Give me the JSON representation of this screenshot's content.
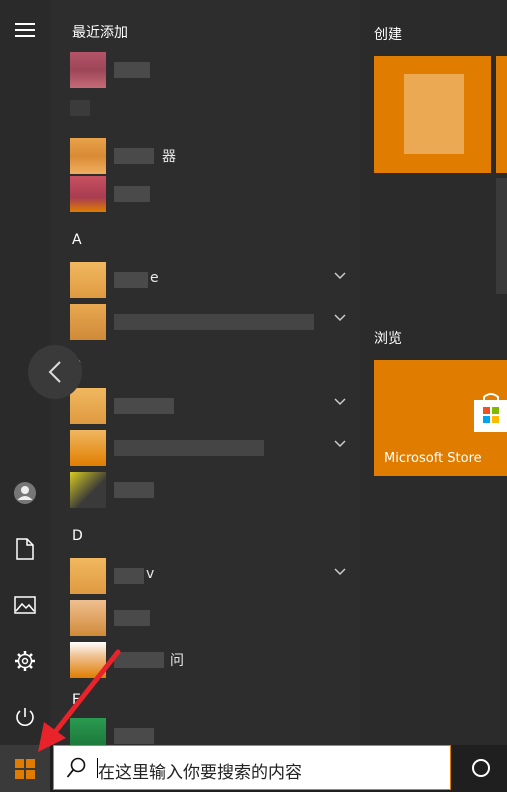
{
  "app_list": {
    "recent_header": "最近添加",
    "sections": [
      "A",
      "B",
      "D",
      "E"
    ],
    "recent_items": [
      {
        "label": "",
        "colors": [
          "#c35a6a",
          "#b05060",
          "#c07070"
        ]
      },
      {
        "label": "器",
        "colors": [
          "#e8a24a",
          "#d98a35",
          "#f0b060"
        ]
      },
      {
        "label": "",
        "colors": [
          "#c85060",
          "#a83c50",
          "#e07d00"
        ]
      }
    ],
    "a_items": [
      {
        "label": "e",
        "expandable": true
      },
      {
        "label": "",
        "expandable": true
      }
    ],
    "b_items": [
      {
        "label": "",
        "expandable": true
      },
      {
        "label": "",
        "expandable": true
      },
      {
        "label": "",
        "expandable": false
      }
    ],
    "d_items": [
      {
        "label": "v",
        "expandable": true
      },
      {
        "label": "",
        "expandable": false
      },
      {
        "label": "问",
        "expandable": false
      }
    ]
  },
  "tiles": {
    "create_group": "创建",
    "browse_group": "浏览",
    "store_label": "Microsoft Store"
  },
  "taskbar": {
    "search_placeholder": "在这里输入你要搜索的内容"
  },
  "colors": {
    "accent": "#e07d00",
    "arrow": "#e8232a"
  }
}
